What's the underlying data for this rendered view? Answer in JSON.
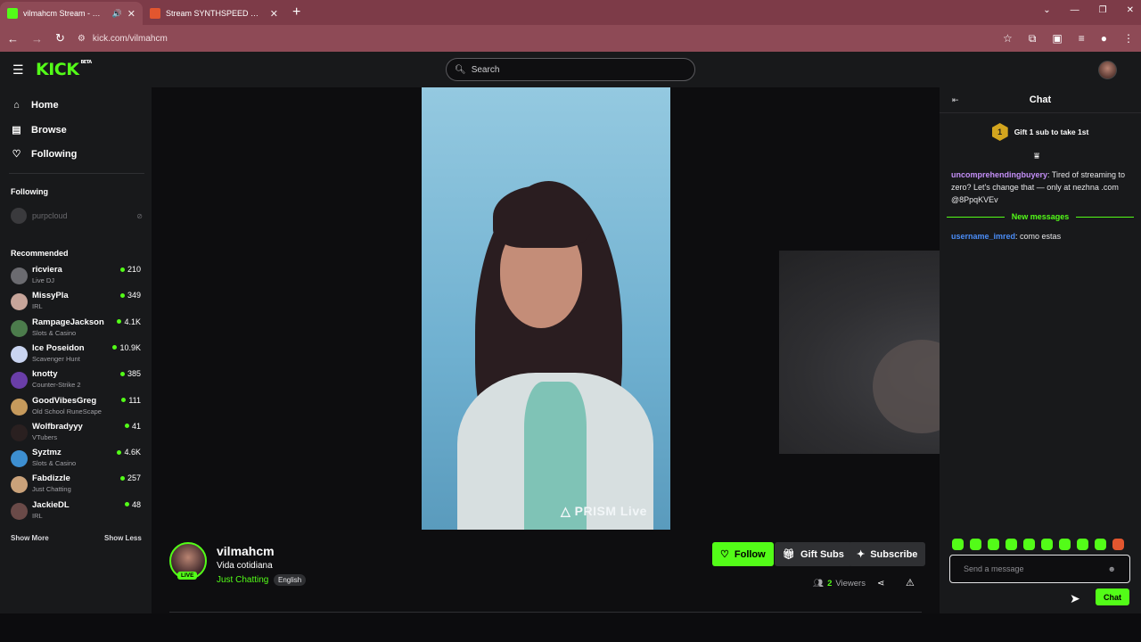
{
  "browser": {
    "tabs": [
      {
        "title": "vilmahcm Stream - Watch Live on Kick",
        "favicon_color": "#53fc18"
      },
      {
        "title": "Stream SYNTHSPEED music | Listen on Spotify",
        "favicon_color": "#e2562f"
      }
    ],
    "url": "kick.com/vilmahcm"
  },
  "header": {
    "logo": "KICK",
    "logo_badge": "BETA",
    "search_placeholder": "Search"
  },
  "sidebar": {
    "nav": [
      {
        "label": "Home",
        "icon": "home-icon"
      },
      {
        "label": "Browse",
        "icon": "browse-icon"
      },
      {
        "label": "Following",
        "icon": "heart-icon"
      }
    ],
    "following_title": "Following",
    "following": [
      {
        "name": "purpcloud",
        "status": "offline"
      }
    ],
    "recommended_title": "Recommended",
    "recommended": [
      {
        "name": "ricviera",
        "category": "Live DJ",
        "viewers": "210",
        "color": "#6b6b70"
      },
      {
        "name": "MissyPla",
        "category": "IRL",
        "viewers": "349",
        "color": "#c7a59a"
      },
      {
        "name": "RampageJackson",
        "category": "Slots & Casino",
        "viewers": "4.1K",
        "color": "#4c7c4c"
      },
      {
        "name": "Ice Poseidon",
        "category": "Scavenger Hunt",
        "viewers": "10.9K",
        "color": "#c9d4f0"
      },
      {
        "name": "knotty",
        "category": "Counter-Strike 2",
        "viewers": "385",
        "color": "#6a3ea8"
      },
      {
        "name": "GoodVibesGreg",
        "category": "Old School RuneScape",
        "viewers": "111",
        "color": "#c69a5c"
      },
      {
        "name": "Wolfbradyyy",
        "category": "VTubers",
        "viewers": "41",
        "color": "#2a2020"
      },
      {
        "name": "Syztmz",
        "category": "Slots & Casino",
        "viewers": "4.6K",
        "color": "#3d8fd1"
      },
      {
        "name": "Fabdizzle",
        "category": "Just Chatting",
        "viewers": "257",
        "color": "#caa27a"
      },
      {
        "name": "JackieDL",
        "category": "IRL",
        "viewers": "48",
        "color": "#6a4a48"
      }
    ],
    "show_more": "Show More",
    "show_less": "Show Less"
  },
  "player": {
    "watermark": "PRISM Live"
  },
  "channel": {
    "name": "vilmahcm",
    "live_badge": "LIVE",
    "title": "Vida cotidiana",
    "category": "Just Chatting",
    "language": "English",
    "follow_label": "Follow",
    "gift_label": "Gift Subs",
    "subscribe_label": "Subscribe",
    "viewers_count": "2",
    "viewers_label": "Viewers"
  },
  "chat": {
    "title": "Chat",
    "gift_rank": "1",
    "gift_prompt": "Gift 1 sub to take 1st",
    "messages": [
      {
        "user": "uncomprehendingbuyery",
        "text": ": Tired of streaming to zero? Let's change that — only at nezhna .com @8PpqKVEv"
      },
      {
        "user": "username_imred",
        "text": ": como estas"
      }
    ],
    "new_messages_label": "New messages",
    "input_placeholder": "Send a message",
    "send_label": "Chat"
  }
}
